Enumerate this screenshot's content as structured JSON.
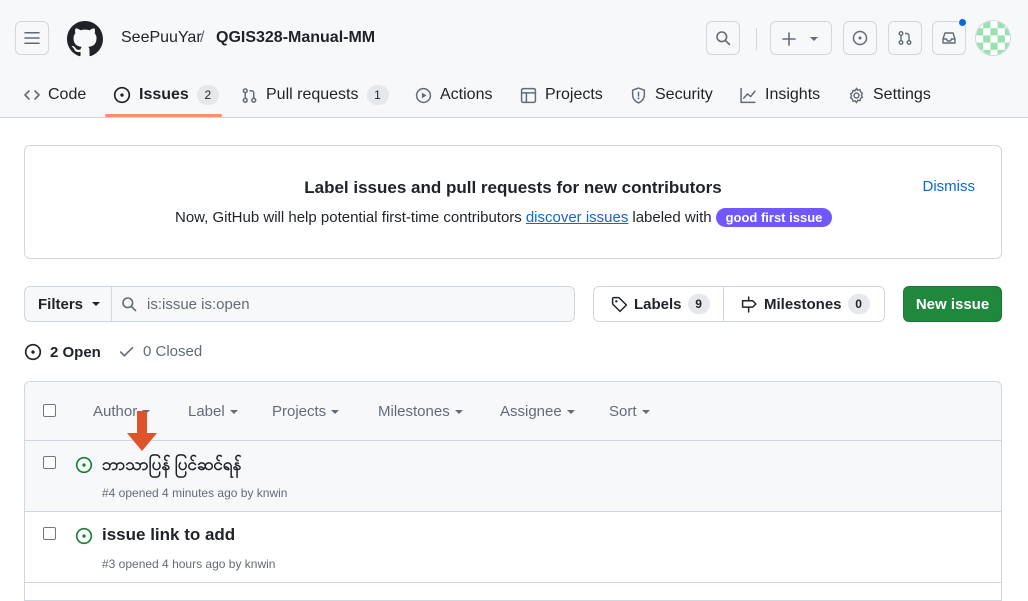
{
  "repo": {
    "owner": "SeePuuYar",
    "slash": "/",
    "name": "QGIS328-Manual-MM"
  },
  "tabs": [
    {
      "label": "Code",
      "icon": "code-icon"
    },
    {
      "label": "Issues",
      "count": "2",
      "icon": "issue-opened-icon",
      "selected": true
    },
    {
      "label": "Pull requests",
      "count": "1",
      "icon": "git-pull-request-icon"
    },
    {
      "label": "Actions",
      "icon": "play-icon"
    },
    {
      "label": "Projects",
      "icon": "table-icon"
    },
    {
      "label": "Security",
      "icon": "shield-icon"
    },
    {
      "label": "Insights",
      "icon": "graph-icon"
    },
    {
      "label": "Settings",
      "icon": "gear-icon"
    }
  ],
  "banner": {
    "title": "Label issues and pull requests for new contributors",
    "text_before": "Now, GitHub will help potential first-time contributors",
    "link": "discover issues",
    "text_after": "labeled with",
    "label": "good first issue",
    "dismiss": "Dismiss"
  },
  "filter": {
    "button": "Filters",
    "query": "is:issue is:open"
  },
  "labels": {
    "label": "Labels",
    "count": "9"
  },
  "milestones": {
    "label": "Milestones",
    "count": "0"
  },
  "new_issue": "New issue",
  "states": {
    "open": "2 Open",
    "closed": "0 Closed"
  },
  "table_header": [
    "Author",
    "Label",
    "Projects",
    "Milestones",
    "Assignee",
    "Sort"
  ],
  "issues": [
    {
      "title": "ဘာသာပြန် ပြင်ဆင်ရန်",
      "meta": "#4 opened 4 minutes ago by knwin"
    },
    {
      "title": "issue link to add",
      "meta": "#3 opened 4 hours ago by knwin"
    }
  ],
  "colors": {
    "accent": "#0969da",
    "open_green": "#1a7f37",
    "primary_button": "#1f883d",
    "good_first_issue": "#7057ff",
    "tab_underline": "#fd8c73",
    "annotation_arrow": "#e0522a"
  }
}
